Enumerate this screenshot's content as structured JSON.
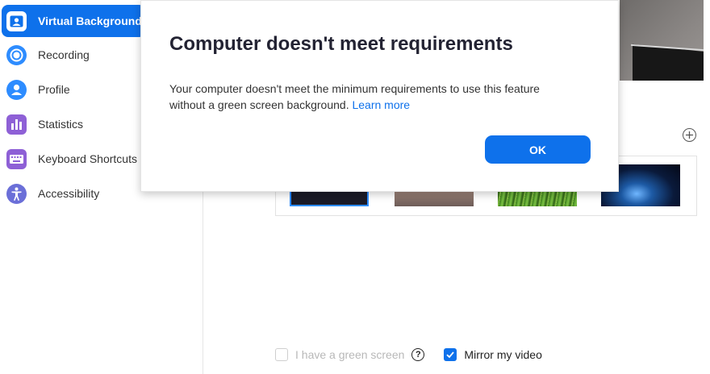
{
  "sidebar": {
    "items": [
      {
        "label": "Virtual Background",
        "icon": "person-background-icon"
      },
      {
        "label": "Recording",
        "icon": "record-icon"
      },
      {
        "label": "Profile",
        "icon": "profile-icon"
      },
      {
        "label": "Statistics",
        "icon": "bar-chart-icon"
      },
      {
        "label": "Keyboard Shortcuts",
        "icon": "keyboard-icon"
      },
      {
        "label": "Accessibility",
        "icon": "accessibility-icon"
      }
    ]
  },
  "dialog": {
    "title": "Computer doesn't meet requirements",
    "message": "Your computer doesn't meet the minimum requirements to use this feature without a green screen background.",
    "link": "Learn more",
    "ok_label": "OK"
  },
  "background_options": {
    "thumbnails": [
      "none",
      "golden-gate-bridge",
      "grass",
      "earth-from-space"
    ]
  },
  "options": {
    "green_screen_label": "I have a green screen",
    "green_screen_checked": false,
    "mirror_label": "Mirror my video",
    "mirror_checked": true
  },
  "colors": {
    "accent": "#0e71eb",
    "sidebar_active_text": "#ffffff"
  }
}
